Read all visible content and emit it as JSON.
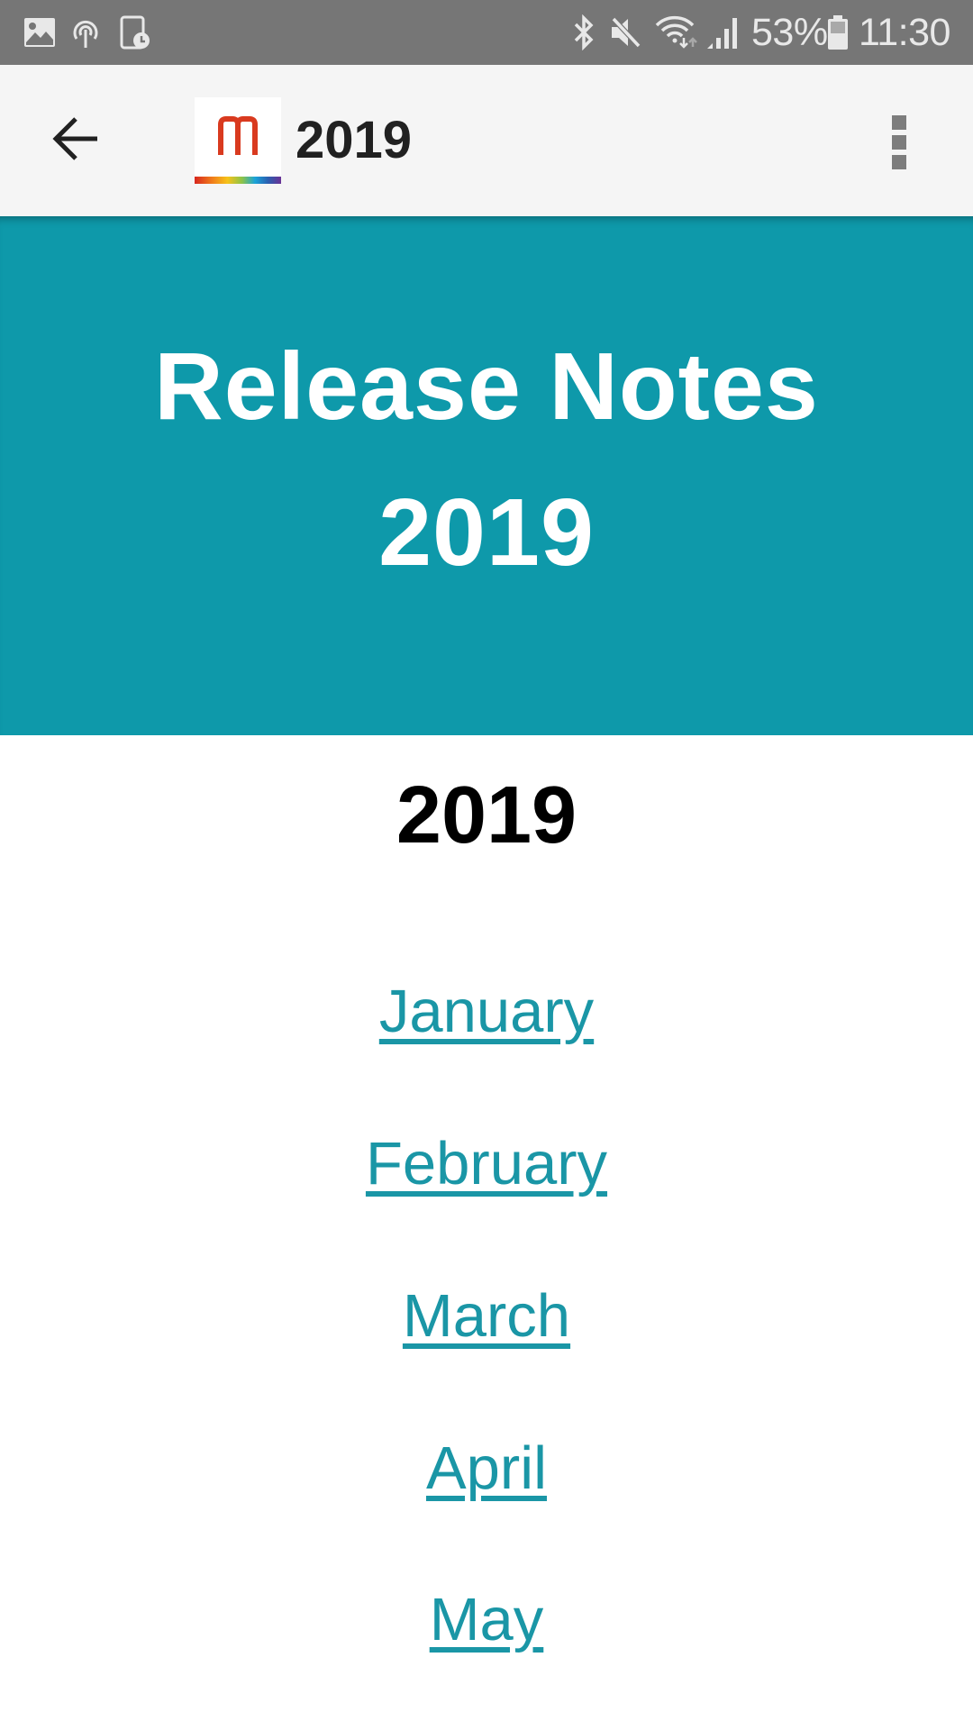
{
  "status_bar": {
    "left_icons": [
      "image-icon",
      "hotspot-icon",
      "screen-timer-icon"
    ],
    "right_icons": [
      "bluetooth-icon",
      "mute-icon",
      "wifi-icon",
      "signal-icon"
    ],
    "battery_percent": "53%",
    "time": "11:30",
    "colors": {
      "background": "#767676",
      "foreground": "#e8e8e8"
    }
  },
  "toolbar": {
    "back_icon": "arrow-back-icon",
    "logo_letter": "M",
    "title": "2019",
    "overflow_icon": "more-vert-icon",
    "colors": {
      "background": "#f5f5f5",
      "logo_red": "#d93a1f",
      "title": "#212121"
    }
  },
  "hero": {
    "title_line1": "Release Notes",
    "title_line2": "2019",
    "colors": {
      "background": "#0e99aa",
      "text": "#ffffff"
    }
  },
  "content": {
    "heading": "2019",
    "months": [
      {
        "label": "January"
      },
      {
        "label": "February"
      },
      {
        "label": "March"
      },
      {
        "label": "April"
      },
      {
        "label": "May"
      }
    ],
    "colors": {
      "link": "#1a96a6",
      "heading": "#000000"
    }
  }
}
